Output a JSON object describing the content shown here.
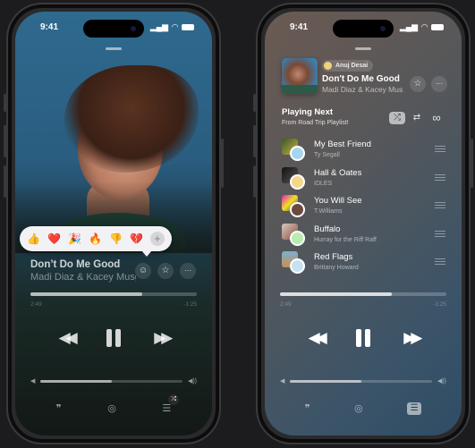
{
  "status_bar": {
    "time": "9:41",
    "signal_icon": "cellular-signal-icon",
    "wifi_icon": "wifi-icon",
    "battery_icon": "battery-icon"
  },
  "left_phone": {
    "reactions": {
      "items": [
        {
          "name": "thumbs-up",
          "glyph": "👍"
        },
        {
          "name": "heart",
          "glyph": "❤️"
        },
        {
          "name": "party-popper",
          "glyph": "🎉"
        },
        {
          "name": "fire",
          "glyph": "🔥"
        },
        {
          "name": "thumbs-down",
          "glyph": "👎"
        },
        {
          "name": "broken-heart",
          "glyph": "💔"
        }
      ],
      "add_glyph": "+"
    },
    "now_playing": {
      "title": "Don’t Do Me Good",
      "artist": "Madi Diaz & Kacey Musgraves",
      "react_glyph": "☺",
      "favorite_glyph": "☆",
      "more_glyph": "···"
    },
    "progress": {
      "elapsed": "2:49",
      "remaining": "-1:25",
      "fraction": 0.67
    },
    "controls": {
      "rewind": "◀◀",
      "forward": "▶▶"
    },
    "volume": {
      "fraction": 0.5,
      "low_glyph": "◀",
      "high_glyph": "◀))"
    },
    "bottom": {
      "lyrics_glyph": "❞",
      "airplay_glyph": "◎",
      "queue_glyph": "☰",
      "shuffle_badge": "⤮"
    }
  },
  "right_phone": {
    "shared_by": "Anuj Desai",
    "now_playing": {
      "title": "Don't Do Me Good",
      "artist": "Madi Diaz & Kacey Musgraves",
      "favorite_glyph": "☆",
      "more_glyph": "···"
    },
    "playing_next": {
      "title": "Playing Next",
      "subtitle": "From Road Trip Playlist!",
      "shuffle_glyph": "⤮",
      "repeat_glyph": "⇄",
      "infinity_glyph": "∞"
    },
    "queue": [
      {
        "title": "My Best Friend",
        "artist": "Ty Segall"
      },
      {
        "title": "Hall & Oates",
        "artist": "IDLES"
      },
      {
        "title": "You Will See",
        "artist": "T.Williams"
      },
      {
        "title": "Buffalo",
        "artist": "Hurray for the Riff Raff"
      },
      {
        "title": "Red Flags",
        "artist": "Brittany Howard"
      }
    ],
    "progress": {
      "elapsed": "2:49",
      "remaining": "-1:25",
      "fraction": 0.67
    },
    "volume": {
      "fraction": 0.5
    },
    "bottom": {
      "lyrics_glyph": "❞",
      "airplay_glyph": "◎",
      "queue_glyph": "☰"
    }
  }
}
